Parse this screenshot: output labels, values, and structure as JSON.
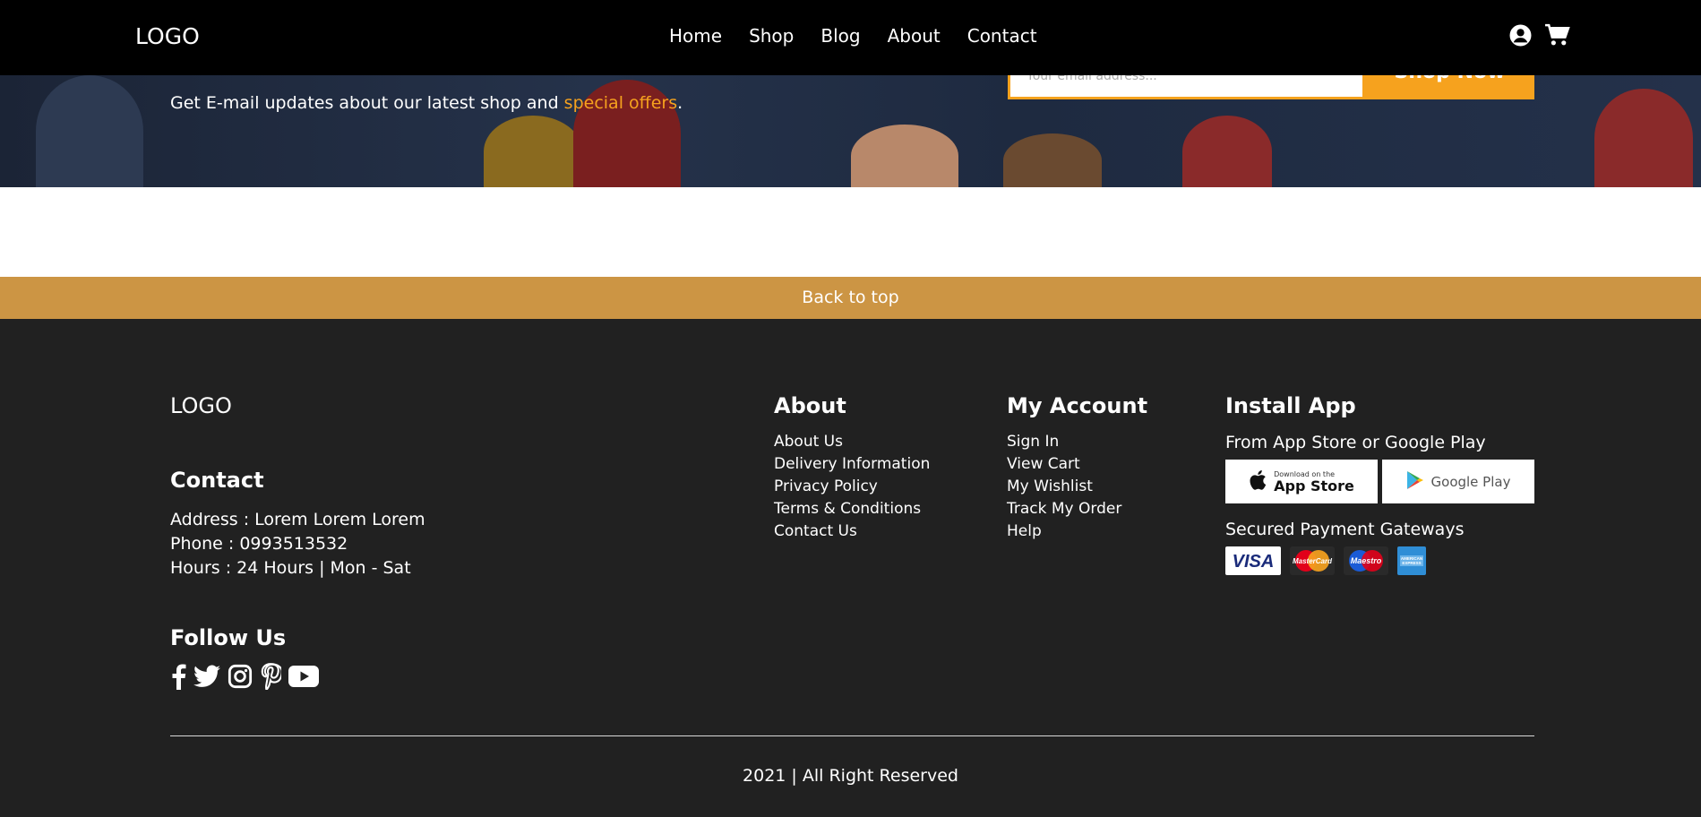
{
  "nav": {
    "logo": "LOGO",
    "links": [
      "Home",
      "Shop",
      "Blog",
      "About",
      "Contact"
    ],
    "icons": [
      "user-icon",
      "cart-icon"
    ]
  },
  "hero": {
    "subtitle_prefix": "Get E-mail updates about our latest shop and ",
    "subtitle_accent": "special offers",
    "subtitle_suffix": ".",
    "email_placeholder": "Your email address...",
    "cta_label": "Shop Now"
  },
  "back_to_top": "Back to top",
  "footer": {
    "logo": "LOGO",
    "contact": {
      "heading": "Contact",
      "address": "Address : Lorem Lorem Lorem",
      "phone": "Phone : 0993513532",
      "hours": "Hours : 24 Hours | Mon - Sat"
    },
    "follow": {
      "heading": "Follow Us",
      "icons": [
        "facebook-icon",
        "twitter-icon",
        "instagram-icon",
        "pinterest-icon",
        "youtube-icon"
      ]
    },
    "about": {
      "heading": "About",
      "links": [
        "About Us",
        "Delivery Information",
        "Privacy Policy",
        "Terms & Conditions",
        "Contact Us"
      ]
    },
    "account": {
      "heading": "My Account",
      "links": [
        "Sign In",
        "View Cart",
        "My Wishlist",
        "Track My Order",
        "Help"
      ]
    },
    "install": {
      "heading": "Install App",
      "subtitle": "From App Store or Google Play",
      "app_store_small": "Download on the",
      "app_store_big": "App Store",
      "google_play": "Google Play",
      "payment_title": "Secured Payment Gateways",
      "payment_cards": [
        "VISA",
        "MasterCard",
        "Maestro",
        "AMERICAN EXPRESS"
      ]
    },
    "copyright": "2021 | All Right Reserved"
  },
  "colors": {
    "accent": "#f6a21e",
    "back_to_top_bg": "#cc9544",
    "footer_bg": "#212121",
    "nav_bg": "#000000"
  }
}
